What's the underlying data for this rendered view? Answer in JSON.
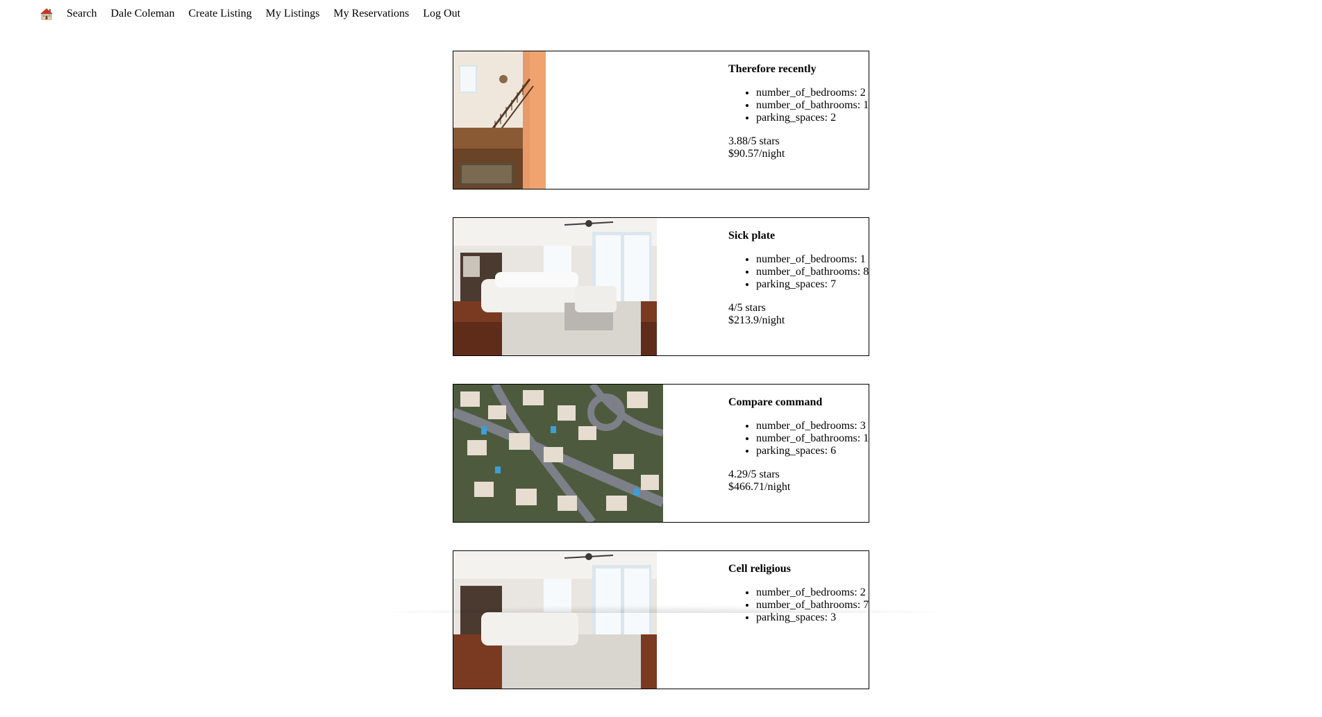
{
  "nav": {
    "home_icon": "house-icon",
    "links": [
      "Search",
      "Dale Coleman",
      "Create Listing",
      "My Listings",
      "My Reservations",
      "Log Out"
    ]
  },
  "listings": [
    {
      "title": "Therefore recently",
      "features": [
        "number_of_bedrooms: 2",
        "number_of_bathrooms: 1",
        "parking_spaces: 2"
      ],
      "rating": "3.88/5 stars",
      "price": "$90.57/night"
    },
    {
      "title": "Sick plate",
      "features": [
        "number_of_bedrooms: 1",
        "number_of_bathrooms: 8",
        "parking_spaces: 7"
      ],
      "rating": "4/5 stars",
      "price": "$213.9/night"
    },
    {
      "title": "Compare command",
      "features": [
        "number_of_bedrooms: 3",
        "number_of_bathrooms: 1",
        "parking_spaces: 6"
      ],
      "rating": "4.29/5 stars",
      "price": "$466.71/night"
    },
    {
      "title": "Cell religious",
      "features": [
        "number_of_bedrooms: 2",
        "number_of_bathrooms: 7",
        "parking_spaces: 3"
      ],
      "rating": "",
      "price": ""
    }
  ]
}
